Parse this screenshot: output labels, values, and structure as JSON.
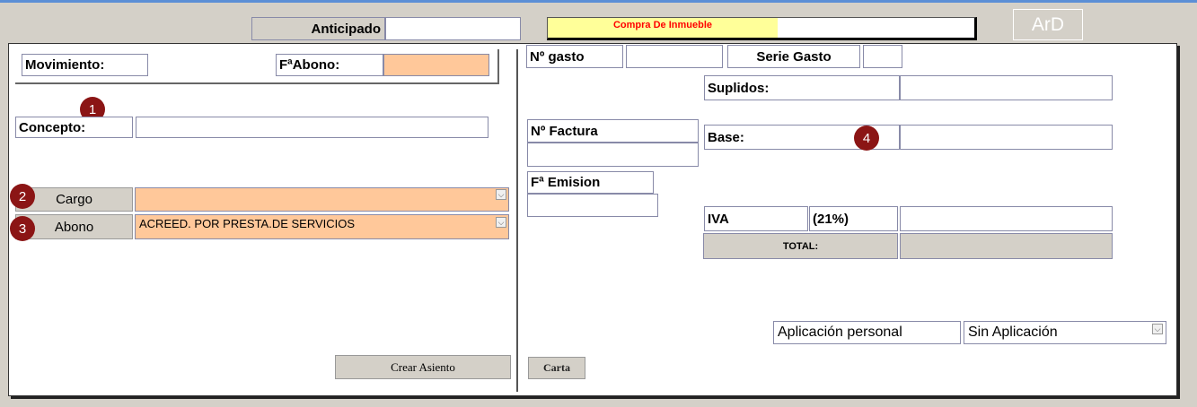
{
  "header": {
    "anticipado_label": "Anticipado",
    "anticipado_value": "",
    "operacion_title": "Compra De Inmueble",
    "logo_text": "ArD"
  },
  "colors": {
    "title_text": "#ff0000",
    "title_bg": "#ffff99",
    "field_highlight": "#ffc89a",
    "marker": "#8b1515"
  },
  "left": {
    "movimiento_label": "Movimiento:",
    "fabono_label": "FªAbono:",
    "fabono_value": "",
    "concepto_label": "Concepto:",
    "concepto_value": "",
    "cargo_label": "Cargo",
    "cargo_value": "",
    "abono_label": "Abono",
    "abono_value": "ACREED. POR PRESTA.DE SERVICIOS",
    "crear_asiento_label": "Crear Asiento"
  },
  "right": {
    "ngasto_label": "Nº gasto",
    "ngasto_value": "",
    "serie_gasto_label": "Serie Gasto",
    "serie_gasto_value": "",
    "suplidos_label": "Suplidos:",
    "suplidos_value": "",
    "nfactura_label": "Nº Factura",
    "nfactura_value": "",
    "base_label": "Base:",
    "base_value": "",
    "femision_label": "Fª Emision",
    "femision_value": "",
    "iva_label": "IVA",
    "iva_rate": "(21%)",
    "iva_value": "",
    "total_label": "TOTAL:",
    "total_value": "",
    "aplicacion_label": "Aplicación personal",
    "aplicacion_value": "Sin Aplicación",
    "carta_label": "Carta"
  },
  "markers": [
    "1",
    "2",
    "3",
    "4"
  ],
  "icons": {
    "dropdown": "chevron-down-icon"
  }
}
